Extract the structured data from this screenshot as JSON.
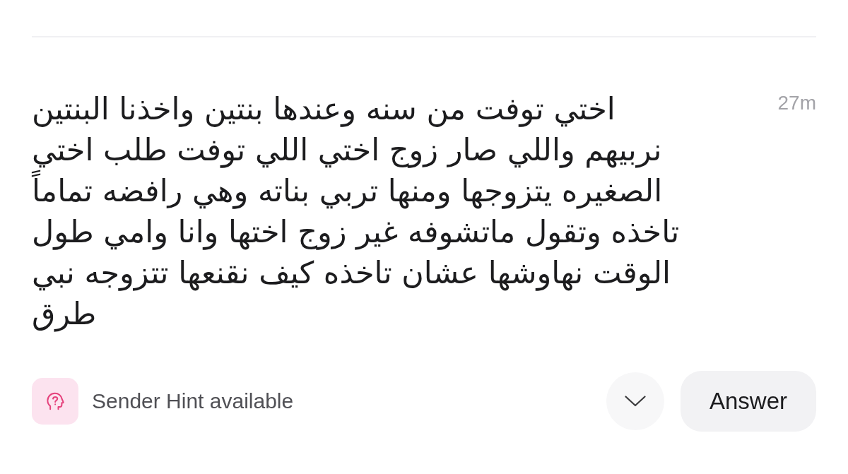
{
  "message": {
    "text": "اختي توفت من سنه وعندها بنتين واخذنا البنتين نربيهم واللي صار زوج اختي اللي توفت طلب اختي الصغيره يتزوجها ومنها تربي بناته وهي رافضه تماماً تاخذه وتقول ماتشوفه غير زوج اختها وانا وامي طول الوقت نهاوشها عشان تاخذه كيف نقنعها تتزوجه نبي طرق",
    "time": "27m"
  },
  "footer": {
    "hint": {
      "label": "Sender Hint available"
    },
    "answer_button": {
      "label": "Answer"
    }
  }
}
